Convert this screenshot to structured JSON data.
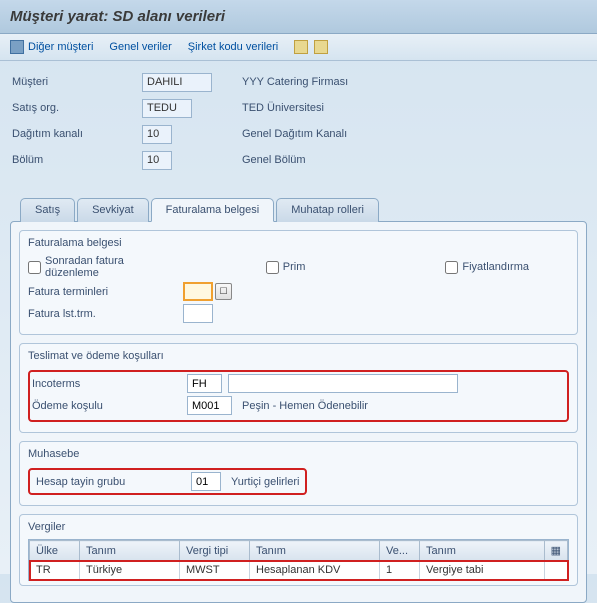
{
  "title": "Müşteri yarat: SD alanı verileri",
  "toolbar": {
    "other_customer": "Diğer müşteri",
    "general_data": "Genel veriler",
    "company_code_data": "Şirket kodu verileri"
  },
  "header": {
    "customer_label": "Müşteri",
    "customer_value": "DAHILI",
    "customer_desc": "YYY Catering Firması",
    "sales_org_label": "Satış org.",
    "sales_org_value": "TEDU",
    "sales_org_desc": "TED Üniversitesi",
    "dist_channel_label": "Dağıtım kanalı",
    "dist_channel_value": "10",
    "dist_channel_desc": "Genel Dağıtım Kanalı",
    "division_label": "Bölüm",
    "division_value": "10",
    "division_desc": "Genel Bölüm"
  },
  "tabs": {
    "sales": "Satış",
    "shipping": "Sevkiyat",
    "billing": "Faturalama belgesi",
    "partners": "Muhatap rolleri"
  },
  "billing_doc": {
    "title": "Faturalama belgesi",
    "later_invoice": "Sonradan fatura düzenleme",
    "prim": "Prim",
    "pricing": "Fiyatlandırma",
    "invoice_terms_label": "Fatura terminleri",
    "invoice_terms_value": "",
    "invoice_list_label": "Fatura lst.trm.",
    "invoice_list_value": ""
  },
  "delivery_payment": {
    "title": "Teslimat ve ödeme koşulları",
    "incoterms_label": "Incoterms",
    "incoterms_value": "FH",
    "incoterms_text": "",
    "payment_terms_label": "Ödeme koşulu",
    "payment_terms_value": "M001",
    "payment_terms_desc": "Peşin - Hemen Ödenebilir"
  },
  "accounting": {
    "title": "Muhasebe",
    "acct_assign_label": "Hesap tayin grubu",
    "acct_assign_value": "01",
    "acct_assign_desc": "Yurtiçi gelirleri"
  },
  "taxes": {
    "title": "Vergiler",
    "columns": {
      "country": "Ülke",
      "desc": "Tanım",
      "tax_type": "Vergi tipi",
      "desc2": "Tanım",
      "tax_class": "Ve...",
      "desc3": "Tanım"
    },
    "rows": [
      {
        "country": "TR",
        "desc": "Türkiye",
        "tax_type": "MWST",
        "desc2": "Hesaplanan KDV",
        "tax_class": "1",
        "desc3": "Vergiye tabi"
      }
    ]
  }
}
